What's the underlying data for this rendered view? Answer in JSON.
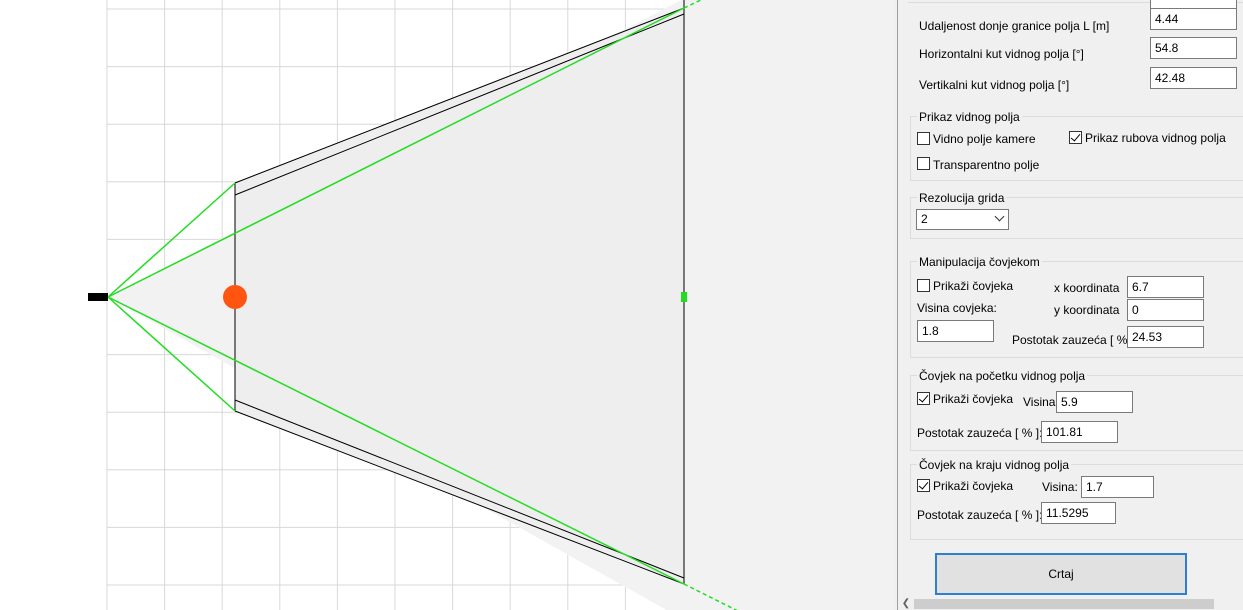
{
  "fields": {
    "lower_boundary": {
      "label": "Udaljenost donje granice polja L [m]",
      "value": "4.44"
    },
    "horizontal_fov": {
      "label": "Horizontalni kut vidnog polja [°]",
      "value": "54.8"
    },
    "vertical_fov": {
      "label": "Vertikalni kut vidnog polja [°]",
      "value": "42.48"
    }
  },
  "display": {
    "title": "Prikaz vidnog polja",
    "camera_fov": {
      "label": "Vidno polje kamere",
      "checked": false
    },
    "fov_edges": {
      "label": "Prikaz rubova vidnog polja",
      "checked": true
    },
    "transparent": {
      "label": "Transparentno polje",
      "checked": false
    }
  },
  "grid": {
    "title": "Rezolucija grida",
    "value": "2"
  },
  "person": {
    "title": "Manipulacija čovjekom",
    "show": {
      "label": "Prikaži čovjeka",
      "checked": false
    },
    "height_label": "Visina covjeka:",
    "height_value": "1.8",
    "x_label": "x koordinata",
    "x_value": "6.7",
    "y_label": "y koordinata",
    "y_value": "0",
    "occupancy_label": "Postotak zauzeća [ % ]:",
    "occupancy_value": "24.53"
  },
  "start_person": {
    "title": "Čovjek na početku vidnog polja",
    "show": {
      "label": "Prikaži čovjeka",
      "checked": true
    },
    "height_label": "Visina:",
    "height_value": "5.9",
    "occupancy_label": "Postotak zauzeća [ % ]:",
    "occupancy_value": "101.81"
  },
  "end_person": {
    "title": "Čovjek na kraju vidnog polja",
    "show": {
      "label": "Prikaži čovjeka",
      "checked": true
    },
    "height_label": "Visina:",
    "height_value": "1.7",
    "occupancy_label": "Postotak zauzeća [ % ]:",
    "occupancy_value": "11.5295"
  },
  "draw_button": "Crtaj",
  "colors": {
    "fov_line": "#22dd22",
    "person_marker": "#ff5511",
    "camera": "#000000",
    "grid": "#d8d8d8",
    "field_fill": "#f2f2f2"
  }
}
